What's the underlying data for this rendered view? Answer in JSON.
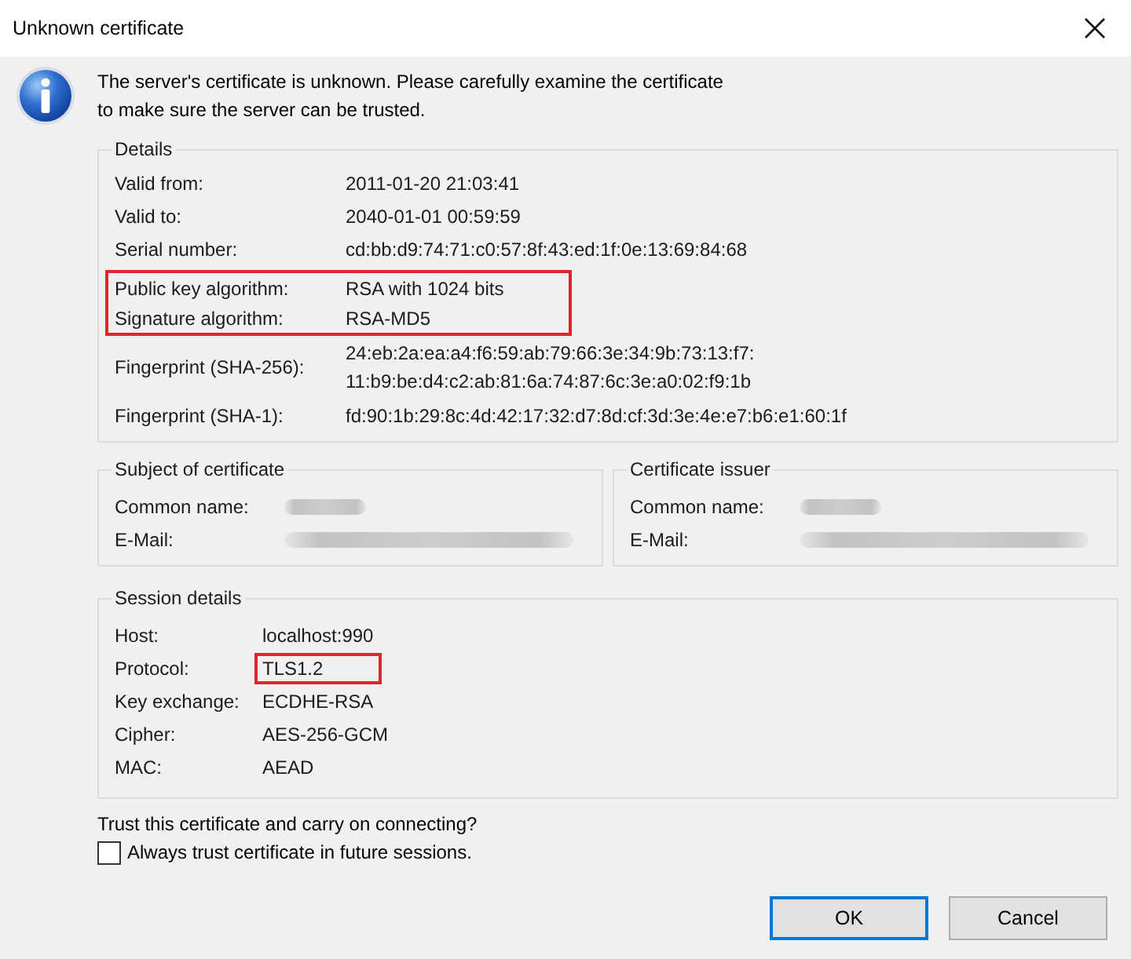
{
  "window": {
    "title": "Unknown certificate"
  },
  "message": "The server's certificate is unknown. Please carefully examine the certificate\nto make sure the server can be trusted.",
  "details": {
    "title": "Details",
    "rows": [
      {
        "label": "Valid from:",
        "value": "2011-01-20 21:03:41",
        "highlighted": false
      },
      {
        "label": "Valid to:",
        "value": "2040-01-01 00:59:59",
        "highlighted": false
      },
      {
        "label": "Serial number:",
        "value": "cd:bb:d9:74:71:c0:57:8f:43:ed:1f:0e:13:69:84:68",
        "highlighted": false
      },
      {
        "label": "Public key algorithm:",
        "value": "RSA with 1024 bits",
        "highlighted": true
      },
      {
        "label": "Signature algorithm:",
        "value": "RSA-MD5",
        "highlighted": true
      },
      {
        "label": "Fingerprint (SHA-256):",
        "value": "24:eb:2a:ea:a4:f6:59:ab:79:66:3e:34:9b:73:13:f7:\n11:b9:be:d4:c2:ab:81:6a:74:87:6c:3e:a0:02:f9:1b",
        "highlighted": false
      },
      {
        "label": "Fingerprint (SHA-1):",
        "value": "fd:90:1b:29:8c:4d:42:17:32:d7:8d:cf:3d:3e:4e:e7:b6:e1:60:1f",
        "highlighted": false
      }
    ]
  },
  "subject": {
    "title": "Subject of certificate",
    "rows": [
      {
        "label": "Common name:",
        "redacted": true
      },
      {
        "label": "E-Mail:",
        "redacted": true
      }
    ]
  },
  "issuer": {
    "title": "Certificate issuer",
    "rows": [
      {
        "label": "Common name:",
        "redacted": true
      },
      {
        "label": "E-Mail:",
        "redacted": true
      }
    ]
  },
  "session": {
    "title": "Session details",
    "rows": [
      {
        "label": "Host:",
        "value": "localhost:990",
        "highlighted": false
      },
      {
        "label": "Protocol:",
        "value": "TLS1.2",
        "highlighted": true
      },
      {
        "label": "Key exchange:",
        "value": "ECDHE-RSA",
        "highlighted": false
      },
      {
        "label": "Cipher:",
        "value": "AES-256-GCM",
        "highlighted": false
      },
      {
        "label": "MAC:",
        "value": "AEAD",
        "highlighted": false
      }
    ]
  },
  "trust": {
    "question": "Trust this certificate and carry on connecting?",
    "checkbox": {
      "label": "Always trust certificate in future sessions.",
      "checked": false
    }
  },
  "buttons": [
    {
      "label": "OK",
      "default": true
    },
    {
      "label": "Cancel",
      "default": false
    }
  ]
}
